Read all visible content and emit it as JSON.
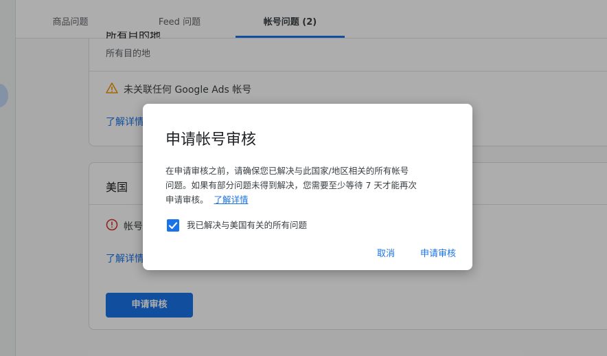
{
  "tabs": [
    {
      "label": "商品问题"
    },
    {
      "label": "Feed 问题"
    },
    {
      "label": "帐号问题 (2)"
    }
  ],
  "card1": {
    "cut_heading": "所有目的地",
    "subtitle": "所有目的地",
    "issue_text": "未关联任何 Google Ads 帐号",
    "learn_more": "了解详情"
  },
  "card2": {
    "heading": "美国",
    "issue_text": "帐号",
    "learn_more": "了解详情",
    "request_button": "申请审核"
  },
  "dialog": {
    "title": "申请帐号审核",
    "body_line1": "在申请审核之前，请确保您已解决与此国家/地区相关的所有帐号",
    "body_line2": "问题。如果有部分问题未得到解决，您需要至少等待 7 天才能再次",
    "body_line3": "申请审核。",
    "learn_more": "了解详情",
    "checkbox_label": "我已解决与美国有关的所有问题",
    "checkbox_checked": true,
    "cancel": "取消",
    "confirm": "申请审核"
  },
  "colors": {
    "accent": "#1a73e8",
    "warning": "#f29900",
    "error": "#d93025"
  }
}
